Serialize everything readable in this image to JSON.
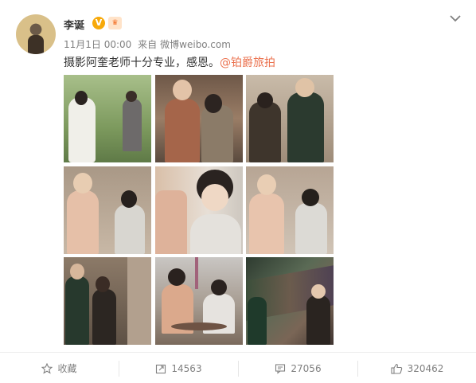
{
  "user": {
    "name": "李诞",
    "verified_badge": "V",
    "level_icon": "vip-icon"
  },
  "meta": {
    "time": "11月1日 00:00",
    "source_prefix": "来自",
    "source": "微博weibo.com"
  },
  "post": {
    "text": "摄影阿奎老师十分专业，感恩。",
    "mention": "@铂爵旅拍"
  },
  "photos": [
    {
      "theme": "garden",
      "colors": [
        "#9bb27a",
        "#e8e8e0"
      ]
    },
    {
      "theme": "street-warm",
      "colors": [
        "#8a6a52",
        "#c9b49a"
      ]
    },
    {
      "theme": "couple-lean",
      "colors": [
        "#4a4038",
        "#c7b9a6"
      ]
    },
    {
      "theme": "street-pink",
      "colors": [
        "#e2c4b0",
        "#d7d7d2"
      ]
    },
    {
      "theme": "closeup",
      "colors": [
        "#d8c2ad",
        "#e9e4de"
      ]
    },
    {
      "theme": "street-smile",
      "colors": [
        "#e7c7b3",
        "#dedbd5"
      ]
    },
    {
      "theme": "green-suit",
      "colors": [
        "#2f4a3a",
        "#b8a597"
      ]
    },
    {
      "theme": "tower-cafe",
      "colors": [
        "#d6a88a",
        "#c9c7c5"
      ]
    },
    {
      "theme": "fabric",
      "colors": [
        "#3d4a3f",
        "#7d6b5d"
      ]
    }
  ],
  "toolbar": {
    "favorite_label": "收藏",
    "repost_count": "14563",
    "comment_count": "27056",
    "like_count": "320462"
  },
  "colors": {
    "mention": "#eb7350",
    "meta_gray": "#808080",
    "vip_orange": "#f7a90a"
  }
}
